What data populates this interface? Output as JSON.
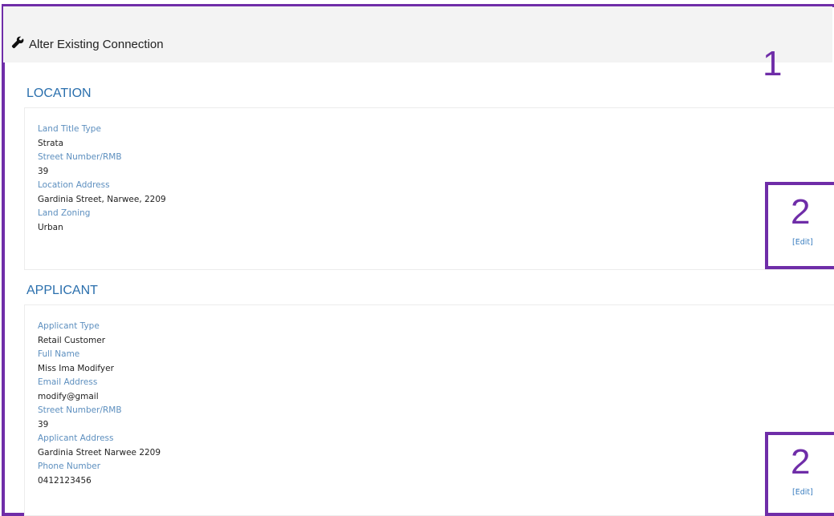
{
  "header": {
    "title": "Alter Existing Connection",
    "icon": "wrench-icon"
  },
  "annotations": {
    "marker_1": "1",
    "marker_2": "2"
  },
  "location": {
    "title": "LOCATION",
    "fields": [
      {
        "label": "Land Title Type",
        "value": "Strata"
      },
      {
        "label": "Street Number/RMB",
        "value": "39"
      },
      {
        "label": "Location Address",
        "value": "Gardinia Street, Narwee, 2209"
      },
      {
        "label": "Land Zoning",
        "value": "Urban"
      }
    ],
    "edit_label": "[Edit]"
  },
  "applicant": {
    "title": "APPLICANT",
    "fields": [
      {
        "label": "Applicant Type",
        "value": "Retail Customer"
      },
      {
        "label": "Full Name",
        "value": "Miss Ima Modifyer"
      },
      {
        "label": "Email Address",
        "value": "modify@gmail"
      },
      {
        "label": "Street Number/RMB",
        "value": "39"
      },
      {
        "label": "Applicant Address",
        "value": "Gardinia Street Narwee 2209"
      },
      {
        "label": "Phone Number",
        "value": "0412123456"
      }
    ],
    "edit_label": "[Edit]"
  },
  "colors": {
    "annotation": "#6f2da8",
    "section_title": "#2a6fad",
    "field_label": "#5d8fbf",
    "link": "#3a7ec0"
  }
}
